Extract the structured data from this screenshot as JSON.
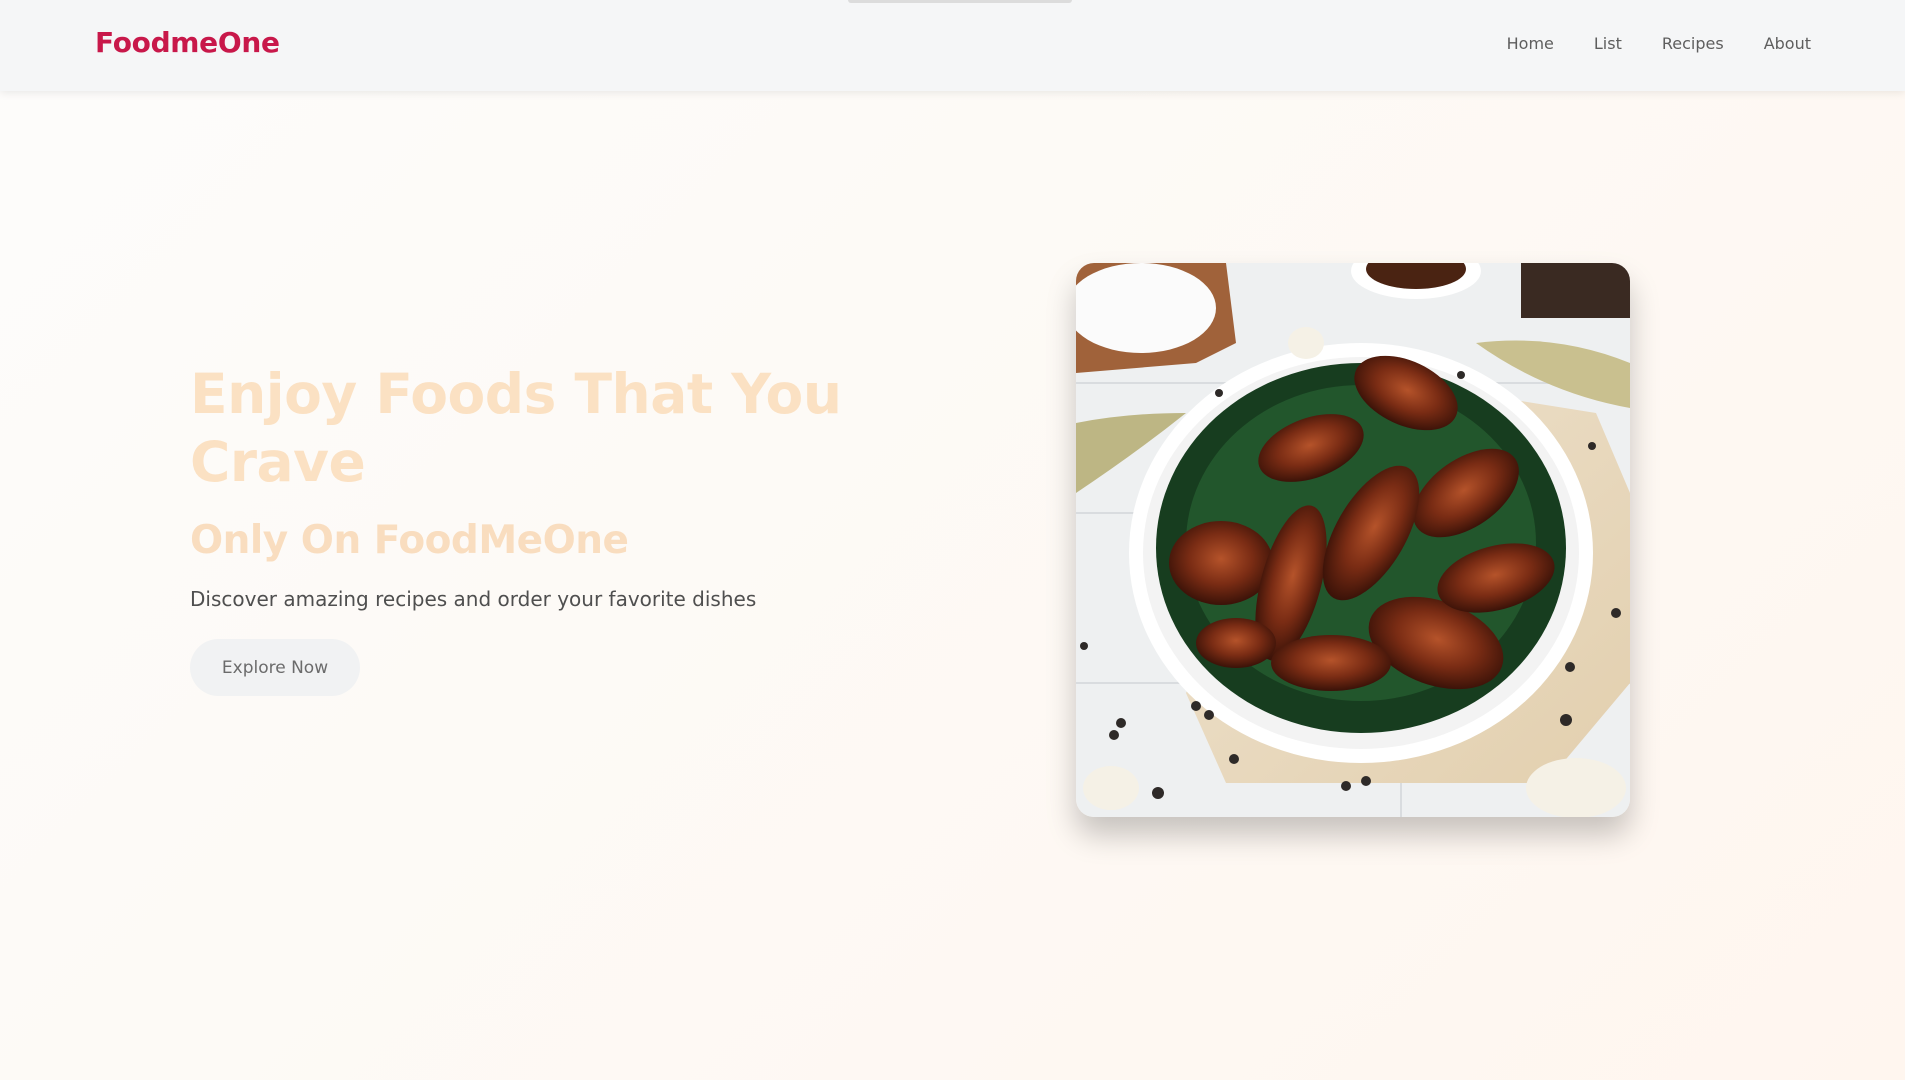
{
  "brand": {
    "name": "FoodmeOne",
    "color": "#c8184a"
  },
  "nav": {
    "links": [
      {
        "label": "Home"
      },
      {
        "label": "List"
      },
      {
        "label": "Recipes"
      },
      {
        "label": "About"
      }
    ]
  },
  "hero": {
    "title": "Enjoy Foods That You Crave",
    "subtitle": "Only On FoodMeOne",
    "description": "Discover amazing recipes and order your favorite dishes",
    "cta_label": "Explore Now",
    "image_icon": "grilled-chicken-wings-photo",
    "title_color": "#fbe1c3"
  }
}
